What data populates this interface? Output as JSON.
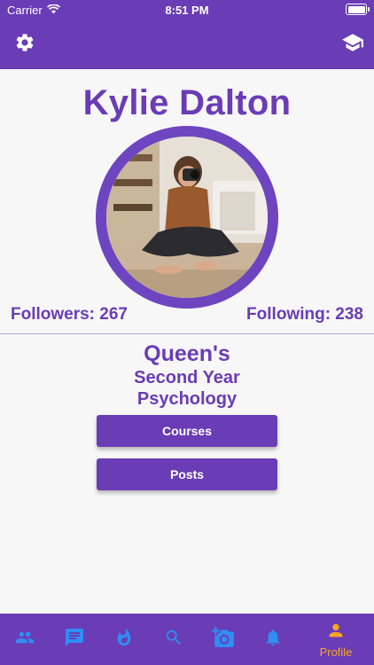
{
  "status_bar": {
    "carrier": "Carrier",
    "time": "8:51 PM"
  },
  "header": {
    "left_icon": "gear-icon",
    "right_icon": "graduation-cap-icon"
  },
  "profile": {
    "name": "Kylie Dalton",
    "followers_label": "Followers: 267",
    "following_label": "Following: 238",
    "school": "Queen's",
    "year": "Second Year",
    "program": "Psychology"
  },
  "buttons": {
    "courses": "Courses",
    "posts": "Posts"
  },
  "tabbar": {
    "items": [
      {
        "icon": "people-icon",
        "label": ""
      },
      {
        "icon": "chat-icon",
        "label": ""
      },
      {
        "icon": "flame-icon",
        "label": ""
      },
      {
        "icon": "search-icon",
        "label": ""
      },
      {
        "icon": "add-photo-icon",
        "label": ""
      },
      {
        "icon": "bell-icon",
        "label": ""
      },
      {
        "icon": "person-icon",
        "label": "Profile",
        "active": true
      }
    ]
  },
  "colors": {
    "primary": "#6a3cb6",
    "tab_icon": "#2f8ef2",
    "active": "#f5a623",
    "background": "#f7f7f8"
  }
}
